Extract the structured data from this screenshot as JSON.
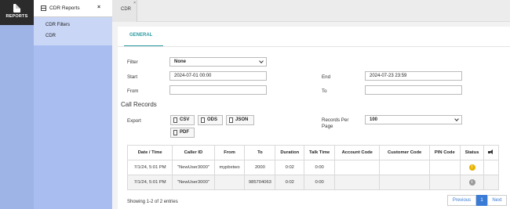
{
  "rail": {
    "icon": "report-document-icon",
    "label": "REPORTS"
  },
  "panel": {
    "title": "CDR Reports",
    "close": "×",
    "items": [
      {
        "label": "CDR Filters"
      },
      {
        "label": "CDR"
      }
    ]
  },
  "tabs": [
    {
      "label": "CDR",
      "close": "×"
    }
  ],
  "form": {
    "general_tab": "GENERAL",
    "filter_label": "Filter",
    "filter_value": "None",
    "start_label": "Start",
    "start_value": "2024-07-01 00:00",
    "end_label": "End",
    "end_value": "2024-07-23 23:59",
    "from_label": "From",
    "from_value": "",
    "to_label": "To",
    "to_value": ""
  },
  "call_records": {
    "title": "Call Records",
    "export_label": "Export",
    "export_buttons": [
      "CSV",
      "ODS",
      "JSON",
      "PDF"
    ],
    "records_per_page_label_1": "Records Per",
    "records_per_page_label_2": "Page",
    "records_per_page_value": "100"
  },
  "table": {
    "headers": [
      "Date / Time",
      "Caller ID",
      "From",
      "To",
      "Duration",
      "Talk Time",
      "Account Code",
      "Customer Code",
      "PIN Code",
      "Status",
      ""
    ],
    "rows": [
      [
        "7/1/24, 5:01 PM",
        "\"NewUser3000\"",
        "mypbxtwo",
        "2000",
        "0:02",
        "0:00",
        "",
        "",
        "",
        "!",
        ""
      ],
      [
        "7/1/24, 5:01 PM",
        "\"NewUser3000\"",
        "",
        "985704063",
        "0:02",
        "0:00",
        "",
        "",
        "",
        "i",
        ""
      ]
    ]
  },
  "footer": {
    "entries": "Showing 1-2 of 2 entries",
    "previous": "Previous",
    "page": "1",
    "next": "Next"
  },
  "colors": {
    "accent": "#2b9aa0",
    "rail": "#9fb4e6",
    "panel": "#a9bdf0",
    "pager_active": "#3a7bd5"
  }
}
